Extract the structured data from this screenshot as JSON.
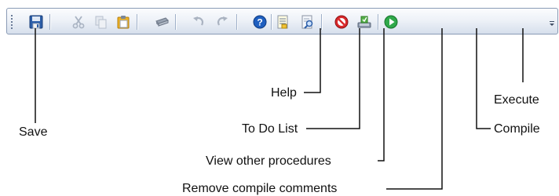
{
  "toolbar": {
    "buttons": [
      {
        "icon": "save-icon",
        "enabled": true
      },
      {
        "icon": "cut-icon",
        "enabled": false
      },
      {
        "icon": "copy-icon",
        "enabled": false
      },
      {
        "icon": "paste-icon",
        "enabled": true
      },
      {
        "icon": "print-icon",
        "enabled": true
      },
      {
        "icon": "undo-icon",
        "enabled": false
      },
      {
        "icon": "redo-icon",
        "enabled": false
      },
      {
        "icon": "help-icon",
        "enabled": true
      },
      {
        "icon": "todo-list-icon",
        "enabled": true
      },
      {
        "icon": "view-procedures-icon",
        "enabled": true
      },
      {
        "icon": "remove-compile-comments-icon",
        "enabled": true
      },
      {
        "icon": "compile-icon",
        "enabled": true
      },
      {
        "icon": "execute-icon",
        "enabled": true
      }
    ],
    "overflow_icon": "chevron-down-icon"
  },
  "callouts": {
    "save": "Save",
    "help": "Help",
    "todo": "To Do List",
    "view_procedures": "View other procedures",
    "remove_compile_comments": "Remove compile comments",
    "compile": "Compile",
    "execute": "Execute"
  },
  "colors": {
    "toolbar_border": "#8a9bb5",
    "help_blue": "#1f5fbf",
    "remove_red": "#d8282a",
    "execute_green": "#2fa84a"
  }
}
